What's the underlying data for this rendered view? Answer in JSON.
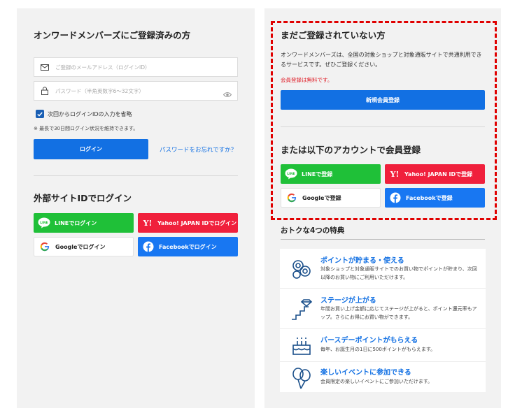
{
  "login": {
    "title": "オンワードメンバーズにご登録済みの方",
    "email_placeholder": "ご登録のメールアドレス（ログインID）",
    "password_placeholder": "パスワード（半角英数字6〜32文字）",
    "remember_label": "次回からログインIDの入力を省略",
    "remember_note": "※ 最長で30日間ログイン状況を維持できます。",
    "login_button": "ログイン",
    "forgot_link": "パスワードをお忘れですか？"
  },
  "external": {
    "title": "外部サイトIDでログイン",
    "line": "LINEでログイン",
    "yahoo": "Yahoo! JAPAN IDでログイン",
    "google": "Googleでログイン",
    "facebook": "Facebookでログイン"
  },
  "register": {
    "title": "まだご登録されていない方",
    "description": "オンワードメンバーズは、全国の対象ショップと対象通販サイトで共通利用できるサービスです。ぜひご登録ください。",
    "free_note": "会員登録は無料です。",
    "new_button": "新規会員登録",
    "social_title": "または以下のアカウントで会員登録",
    "line": "LINEで登録",
    "yahoo": "Yahoo! JAPAN IDで登録",
    "google": "Googleで登録",
    "facebook": "Facebookで登録"
  },
  "benefits": {
    "title": "おトクな4つの特典",
    "items": [
      {
        "title": "ポイントが貯まる・使える",
        "desc": "対象ショップと対象通販サイトでのお買い物でポイントが貯まり、次回以降のお買い物にご利用いただけます。",
        "icon": "coins-icon"
      },
      {
        "title": "ステージが上がる",
        "desc": "年間お買い上げ金額に応じてステージが上がると、ポイント還元率もアップ。さらにお得にお買い物ができます。",
        "icon": "stairs-diamond-icon"
      },
      {
        "title": "バースデーポイントがもらえる",
        "desc": "毎年、お誕生月の1日に500ポイントがもらえます。",
        "icon": "cake-icon"
      },
      {
        "title": "楽しいイベントに参加できる",
        "desc": "会員限定の楽しいイベントにご参加いただけます。",
        "icon": "balloons-icon"
      }
    ]
  },
  "colors": {
    "primary": "#1270e3",
    "line": "#1fc038",
    "yahoo": "#f0203c",
    "facebook": "#1877f2",
    "highlight": "#e00000"
  }
}
